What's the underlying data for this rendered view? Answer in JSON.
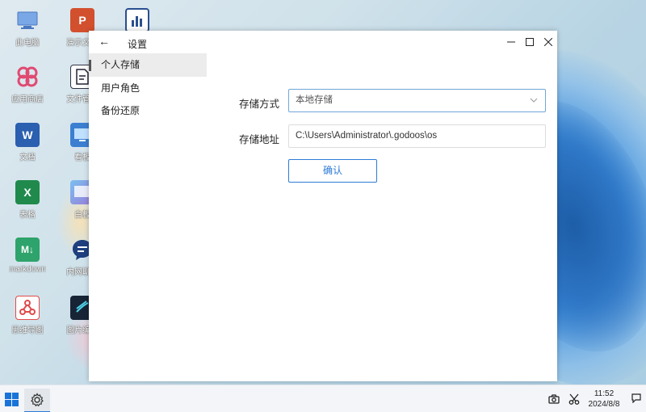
{
  "desktop": {
    "icons": [
      {
        "label": "此电脑",
        "name": "this-pc",
        "glyph": "",
        "color": "#5b8fd9"
      },
      {
        "label": "演示文稿",
        "name": "presentation",
        "glyph": "P",
        "color": "#d2502e"
      },
      {
        "label": "",
        "name": "chart-app",
        "glyph": "",
        "color": "#2a4f8f"
      },
      {
        "label": "应用商店",
        "name": "app-store",
        "glyph": "",
        "color": "#ffffff"
      },
      {
        "label": "文件管理",
        "name": "file-manager",
        "glyph": "",
        "color": "#ffffff"
      },
      {
        "label": "文档",
        "name": "word-doc",
        "glyph": "W",
        "color": "#2b5faf"
      },
      {
        "label": "看板",
        "name": "kanban",
        "glyph": "",
        "color": "#3c7fd1"
      },
      {
        "label": "表格",
        "name": "excel",
        "glyph": "X",
        "color": "#1f8a4c"
      },
      {
        "label": "白板",
        "name": "whiteboard",
        "glyph": "",
        "color": "#6b7fd9"
      },
      {
        "label": "markdown",
        "name": "markdown",
        "glyph": "M↓",
        "color": "#2ea36b"
      },
      {
        "label": "内网聊天",
        "name": "chat",
        "glyph": "",
        "color": "#1f3f7f"
      },
      {
        "label": "思维导图",
        "name": "mindmap",
        "glyph": "",
        "color": "#ffffff"
      },
      {
        "label": "图片编辑",
        "name": "image-editor",
        "glyph": "",
        "color": "#162436"
      }
    ]
  },
  "window": {
    "title": "设置",
    "back_glyph": "←",
    "sidebar": [
      {
        "label": "个人存储",
        "active": true
      },
      {
        "label": "用户角色",
        "active": false
      },
      {
        "label": "备份还原",
        "active": false
      }
    ],
    "form": {
      "storage_method_label": "存储方式",
      "storage_method_value": "本地存储",
      "storage_path_label": "存储地址",
      "storage_path_value": "C:\\Users\\Administrator\\.godoos\\os",
      "confirm_label": "确认"
    }
  },
  "taskbar": {
    "time": "11:52",
    "date": "2024/8/8"
  },
  "colors": {
    "accent": "#2d7bd6",
    "select_border": "#6fa7d8"
  }
}
